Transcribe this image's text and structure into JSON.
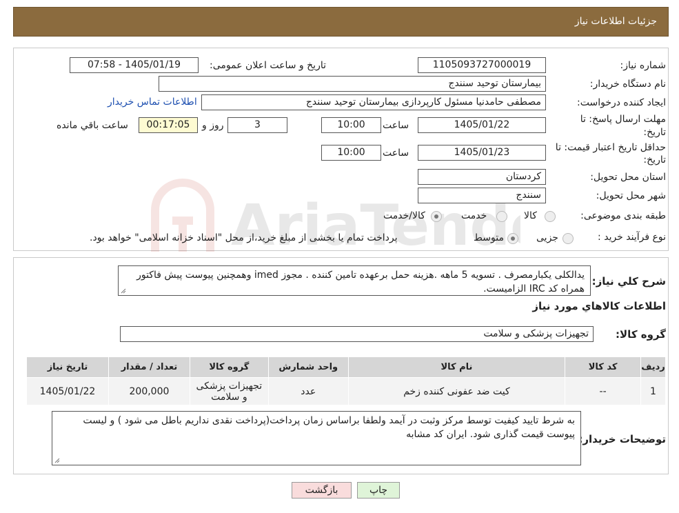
{
  "header": {
    "title": "جزئیات اطلاعات نیاز"
  },
  "form": {
    "need_number_label": "شماره نیاز:",
    "need_number": "1105093727000019",
    "announce_label": "تاریخ و ساعت اعلان عمومی:",
    "announce_value": "1405/01/19 - 07:58",
    "buyer_org_label": "نام دستگاه خریدار:",
    "buyer_org": "بیمارستان توحید سنندج",
    "requester_label": "ایجاد کننده درخواست:",
    "requester": "مصطفی حامدنیا مسئول کارپردازی بیمارستان توحید سنندج",
    "contact_link": "اطلاعات تماس خریدار",
    "deadline_label_1": "مهلت ارسال پاسخ: تا",
    "deadline_label_2": "تاریخ:",
    "deadline_date": "1405/01/22",
    "time_label": "ساعت",
    "deadline_time": "10:00",
    "days_value": "3",
    "days_label": "روز و",
    "remaining_time": "00:17:05",
    "remaining_label": "ساعت باقي مانده",
    "validity_label_1": "حداقل تاریخ اعتبار قیمت: تا",
    "validity_label_2": "تاریخ:",
    "validity_date": "1405/01/23",
    "validity_time": "10:00",
    "province_label": "استان محل تحویل:",
    "province": "کردستان",
    "city_label": "شهر محل تحویل:",
    "city": "سنندج",
    "category_label": "طبقه بندی موضوعی:",
    "category_options": [
      "کالا",
      "خدمت",
      "کالا/خدمت"
    ],
    "process_label": "نوع فرآیند خرید :",
    "process_options": [
      "جزیی",
      "متوسط"
    ],
    "process_note": "پرداخت تمام یا بخشی از مبلغ خرید،از محل \"اسناد خزانه اسلامی\" خواهد بود."
  },
  "description": {
    "label": "شرح کلي نياز:",
    "text": "یدالکلی یکبارمصرف . تسویه 5 ماهه .هزینه حمل برعهده تامین کننده . مجوز imed وهمچنین پیوست پیش فاکتور همراه کد IRC  الزامیست."
  },
  "goods": {
    "section_title": "اطلاعات کالاهاي مورد نياز",
    "group_label": "گروه کالا:",
    "group_value": "تجهیزات پزشکی و سلامت"
  },
  "table": {
    "headers": [
      "ردیف",
      "کد کالا",
      "نام کالا",
      "واحد شمارش",
      "گروه کالا",
      "تعداد / مقدار",
      "تاریخ نیاز"
    ],
    "rows": [
      [
        "1",
        "--",
        "کیت ضد عفونی کننده زخم",
        "عدد",
        "تجهیزات پزشکی و سلامت",
        "200,000",
        "1405/01/22"
      ]
    ]
  },
  "buyer_notes": {
    "label": "توضیحات خریدار:",
    "text": "به شرط تایید کیفیت توسط مرکز وثبت در آیمد ولطفا براساس زمان پرداخت(پرداخت نقدی نداریم باطل می شود ) و لیست پیوست قیمت گذاری شود. ایران کد مشابه"
  },
  "buttons": {
    "print": "چاپ",
    "back": "بازگشت"
  },
  "watermark_text": "AriaTender.neT",
  "colors": {
    "header_bg": "#8b6b3e",
    "link": "#1d4fb0",
    "remaining_bg": "#fefbd2",
    "back_bg": "#f9dcdc",
    "print_bg": "#dff4d8"
  }
}
